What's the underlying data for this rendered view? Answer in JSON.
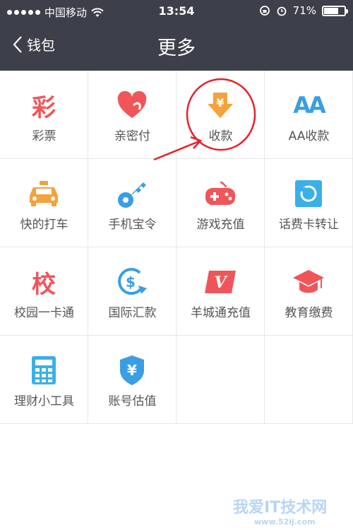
{
  "status_bar": {
    "carrier": "中国移动",
    "time": "13:54",
    "battery_percent_text": "71%",
    "battery_level": 0.71
  },
  "nav": {
    "back_label": "钱包",
    "title": "更多"
  },
  "tiles": [
    {
      "label": "彩票",
      "icon": "lottery-icon",
      "glyph": "彩",
      "color": "#f0555a"
    },
    {
      "label": "亲密付",
      "icon": "heart-pay-icon",
      "color": "#f0555a"
    },
    {
      "label": "收款",
      "icon": "receive-money-icon",
      "glyph": "¥",
      "color": "#f5a13c"
    },
    {
      "label": "AA收款",
      "icon": "aa-collect-icon",
      "glyph": "AA",
      "color": "#3a9ee4"
    },
    {
      "label": "快的打车",
      "icon": "taxi-icon",
      "color": "#f5a13c"
    },
    {
      "label": "手机宝令",
      "icon": "key-icon",
      "color": "#3a9ee4"
    },
    {
      "label": "游戏充值",
      "icon": "gamepad-icon",
      "color": "#f0555a"
    },
    {
      "label": "话费卡转让",
      "icon": "phone-card-icon",
      "color": "#3ab0e8"
    },
    {
      "label": "校园一卡通",
      "icon": "campus-card-icon",
      "glyph": "校",
      "color": "#f0555a"
    },
    {
      "label": "国际汇款",
      "icon": "international-remit-icon",
      "glyph": "$",
      "color": "#3a9ee4"
    },
    {
      "label": "羊城通充值",
      "icon": "yct-card-icon",
      "glyph": "V",
      "color": "#f0555a"
    },
    {
      "label": "教育缴费",
      "icon": "graduation-cap-icon",
      "color": "#f0555a"
    },
    {
      "label": "理财小工具",
      "icon": "calculator-icon",
      "color": "#3ab0e8"
    },
    {
      "label": "账号估值",
      "icon": "shield-yen-icon",
      "glyph": "¥",
      "color": "#3a9ee4"
    }
  ],
  "annotation_color": "#e8202a",
  "watermark": {
    "text": "我爱IT技术网",
    "sub": "www.52ij.com"
  }
}
